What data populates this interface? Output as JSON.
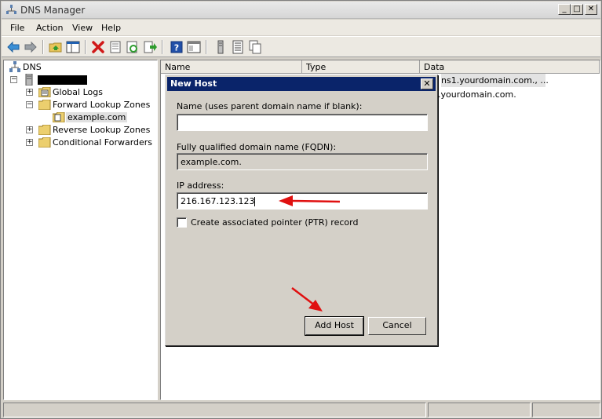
{
  "window": {
    "title": "DNS Manager",
    "controls": {
      "minimize": "_",
      "maximize": "□",
      "close": "✕"
    }
  },
  "menu": [
    "File",
    "Action",
    "View",
    "Help"
  ],
  "toolbar": {
    "icons": [
      "back-icon",
      "forward-icon",
      "up-folder-icon",
      "show-hide-tree-icon",
      "delete-icon",
      "properties-icon",
      "refresh-icon",
      "export-list-icon",
      "help-icon",
      "console-icon",
      "new-record-icon",
      "list-icon",
      "copy-icon"
    ]
  },
  "tree": {
    "root": "DNS",
    "server": "",
    "items": [
      {
        "label": "Global Logs",
        "expander": "+"
      },
      {
        "label": "Forward Lookup Zones",
        "expander": "−"
      },
      {
        "label": "example.com",
        "expander": ""
      },
      {
        "label": "Reverse Lookup Zones",
        "expander": "+"
      },
      {
        "label": "Conditional Forwarders",
        "expander": "+"
      }
    ]
  },
  "list": {
    "columns": [
      "Name",
      "Type",
      "Data"
    ],
    "rows": [
      {
        "data": "ns1.yourdomain.com., ..."
      },
      {
        "data": ".yourdomain.com."
      }
    ]
  },
  "dialog": {
    "title": "New Host",
    "close": "✕",
    "name_label": "Name (uses parent domain name if blank):",
    "name_value": "",
    "fqdn_label": "Fully qualified domain name (FQDN):",
    "fqdn_value": "example.com.",
    "ip_label": "IP address:",
    "ip_value": "216.167.123.123",
    "ptr_label": "Create associated pointer (PTR) record",
    "ptr_checked": false,
    "add_button": "Add Host",
    "cancel_button": "Cancel"
  },
  "colors": {
    "dialog_title": "#0a246a",
    "annotation_arrow": "#e01010"
  }
}
